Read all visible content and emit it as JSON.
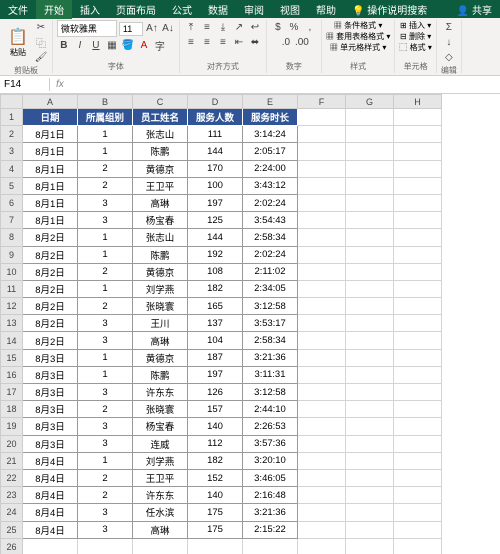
{
  "titlebar": {
    "file": "文件",
    "tabs": [
      "开始",
      "插入",
      "页面布局",
      "公式",
      "数据",
      "审阅",
      "视图",
      "帮助"
    ],
    "search": "操作说明搜索",
    "share": "共享"
  },
  "ribbon": {
    "clipboard": {
      "paste": "粘贴",
      "label": "剪贴板"
    },
    "font": {
      "name": "微软雅黑",
      "size": "11",
      "label": "字体"
    },
    "align": {
      "label": "对齐方式"
    },
    "number": {
      "label": "数字"
    },
    "styles": {
      "cond": "条件格式",
      "tblfmt": "套用表格格式",
      "cellstyle": "单元格样式",
      "label": "样式"
    },
    "cells": {
      "insert": "插入",
      "delete": "删除",
      "format": "格式",
      "label": "单元格"
    },
    "edit": {
      "label": "编辑"
    }
  },
  "formula_bar": {
    "name": "F14",
    "fx": "fx",
    "value": ""
  },
  "columns": [
    "A",
    "B",
    "C",
    "D",
    "E",
    "F",
    "G",
    "H"
  ],
  "headers": [
    "日期",
    "所属组别",
    "员工姓名",
    "服务人数",
    "服务时长"
  ],
  "chart_data": {
    "type": "table",
    "columns": [
      "日期",
      "所属组别",
      "员工姓名",
      "服务人数",
      "服务时长"
    ],
    "rows": [
      [
        "8月1日",
        "1",
        "张志山",
        "111",
        "3:14:24"
      ],
      [
        "8月1日",
        "1",
        "陈鹏",
        "144",
        "2:05:17"
      ],
      [
        "8月1日",
        "2",
        "黄德京",
        "170",
        "2:24:00"
      ],
      [
        "8月1日",
        "2",
        "王卫平",
        "100",
        "3:43:12"
      ],
      [
        "8月1日",
        "3",
        "高琳",
        "197",
        "2:02:24"
      ],
      [
        "8月1日",
        "3",
        "杨宝春",
        "125",
        "3:54:43"
      ],
      [
        "8月2日",
        "1",
        "张志山",
        "144",
        "2:58:34"
      ],
      [
        "8月2日",
        "1",
        "陈鹏",
        "192",
        "2:02:24"
      ],
      [
        "8月2日",
        "2",
        "黄德京",
        "108",
        "2:11:02"
      ],
      [
        "8月2日",
        "1",
        "刘学燕",
        "182",
        "2:34:05"
      ],
      [
        "8月2日",
        "2",
        "张晓寰",
        "165",
        "3:12:58"
      ],
      [
        "8月2日",
        "3",
        "王川",
        "137",
        "3:53:17"
      ],
      [
        "8月2日",
        "3",
        "高琳",
        "104",
        "2:58:34"
      ],
      [
        "8月3日",
        "1",
        "黄德京",
        "187",
        "3:21:36"
      ],
      [
        "8月3日",
        "1",
        "陈鹏",
        "197",
        "3:11:31"
      ],
      [
        "8月3日",
        "3",
        "许东东",
        "126",
        "3:12:58"
      ],
      [
        "8月3日",
        "2",
        "张晓寰",
        "157",
        "2:44:10"
      ],
      [
        "8月3日",
        "3",
        "杨宝春",
        "140",
        "2:26:53"
      ],
      [
        "8月3日",
        "3",
        "连威",
        "112",
        "3:57:36"
      ],
      [
        "8月4日",
        "1",
        "刘学燕",
        "182",
        "3:20:10"
      ],
      [
        "8月4日",
        "2",
        "王卫平",
        "152",
        "3:46:05"
      ],
      [
        "8月4日",
        "2",
        "许东东",
        "140",
        "2:16:48"
      ],
      [
        "8月4日",
        "3",
        "任水滨",
        "175",
        "3:21:36"
      ],
      [
        "8月4日",
        "3",
        "高琳",
        "175",
        "2:15:22"
      ]
    ]
  }
}
